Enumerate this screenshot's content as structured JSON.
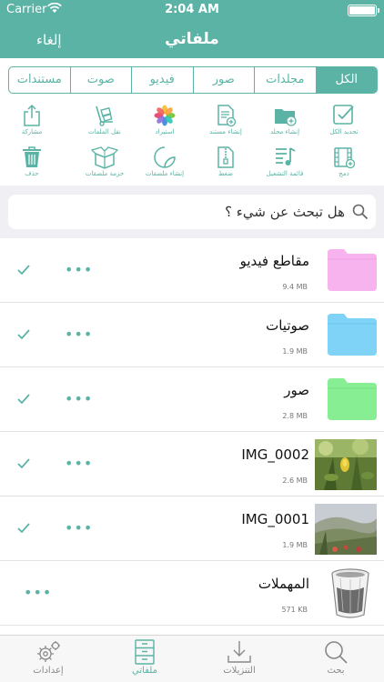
{
  "status": {
    "carrier": "Carrier",
    "time": "2:04 AM"
  },
  "nav": {
    "title": "ملفاتي",
    "cancel": "إلغاء"
  },
  "segments": [
    "الكل",
    "مجلدات",
    "صور",
    "فيديو",
    "صوت",
    "مستندات"
  ],
  "tools": {
    "select_all": "تحديد الكل",
    "create_folder": "إنشاء مجلد",
    "create_document": "إنشاء مستند",
    "import": "استيراد",
    "move_files": "نقل الملفات",
    "share": "مشاركة",
    "merge": "دمج",
    "playlist": "قائمة التشغيل",
    "compress": "ضغط",
    "create_sticker": "إنشاء ملصقات",
    "sticker_pack": "حزمة ملصقات",
    "delete": "حذف"
  },
  "search": {
    "placeholder": "هل تبحث عن شيء ؟"
  },
  "files": [
    {
      "name": "مقاطع فيديو",
      "size": "9.4 MB",
      "type": "folder",
      "color": "#f7b3ee"
    },
    {
      "name": "صوتيات",
      "size": "1.9 MB",
      "type": "folder",
      "color": "#7fd3f7"
    },
    {
      "name": "صور",
      "size": "2.8 MB",
      "type": "folder",
      "color": "#88ee94"
    },
    {
      "name": "IMG_0002",
      "size": "2.6 MB",
      "type": "image"
    },
    {
      "name": "IMG_0001",
      "size": "1.9 MB",
      "type": "image"
    },
    {
      "name": "المهملات",
      "size": "571 KB",
      "type": "trash"
    }
  ],
  "tabs": {
    "settings": "إعدادات",
    "my_files": "ملفاتي",
    "downloads": "التنزيلات",
    "search": "بحث"
  },
  "colors": {
    "accent": "#5bb3a6"
  }
}
